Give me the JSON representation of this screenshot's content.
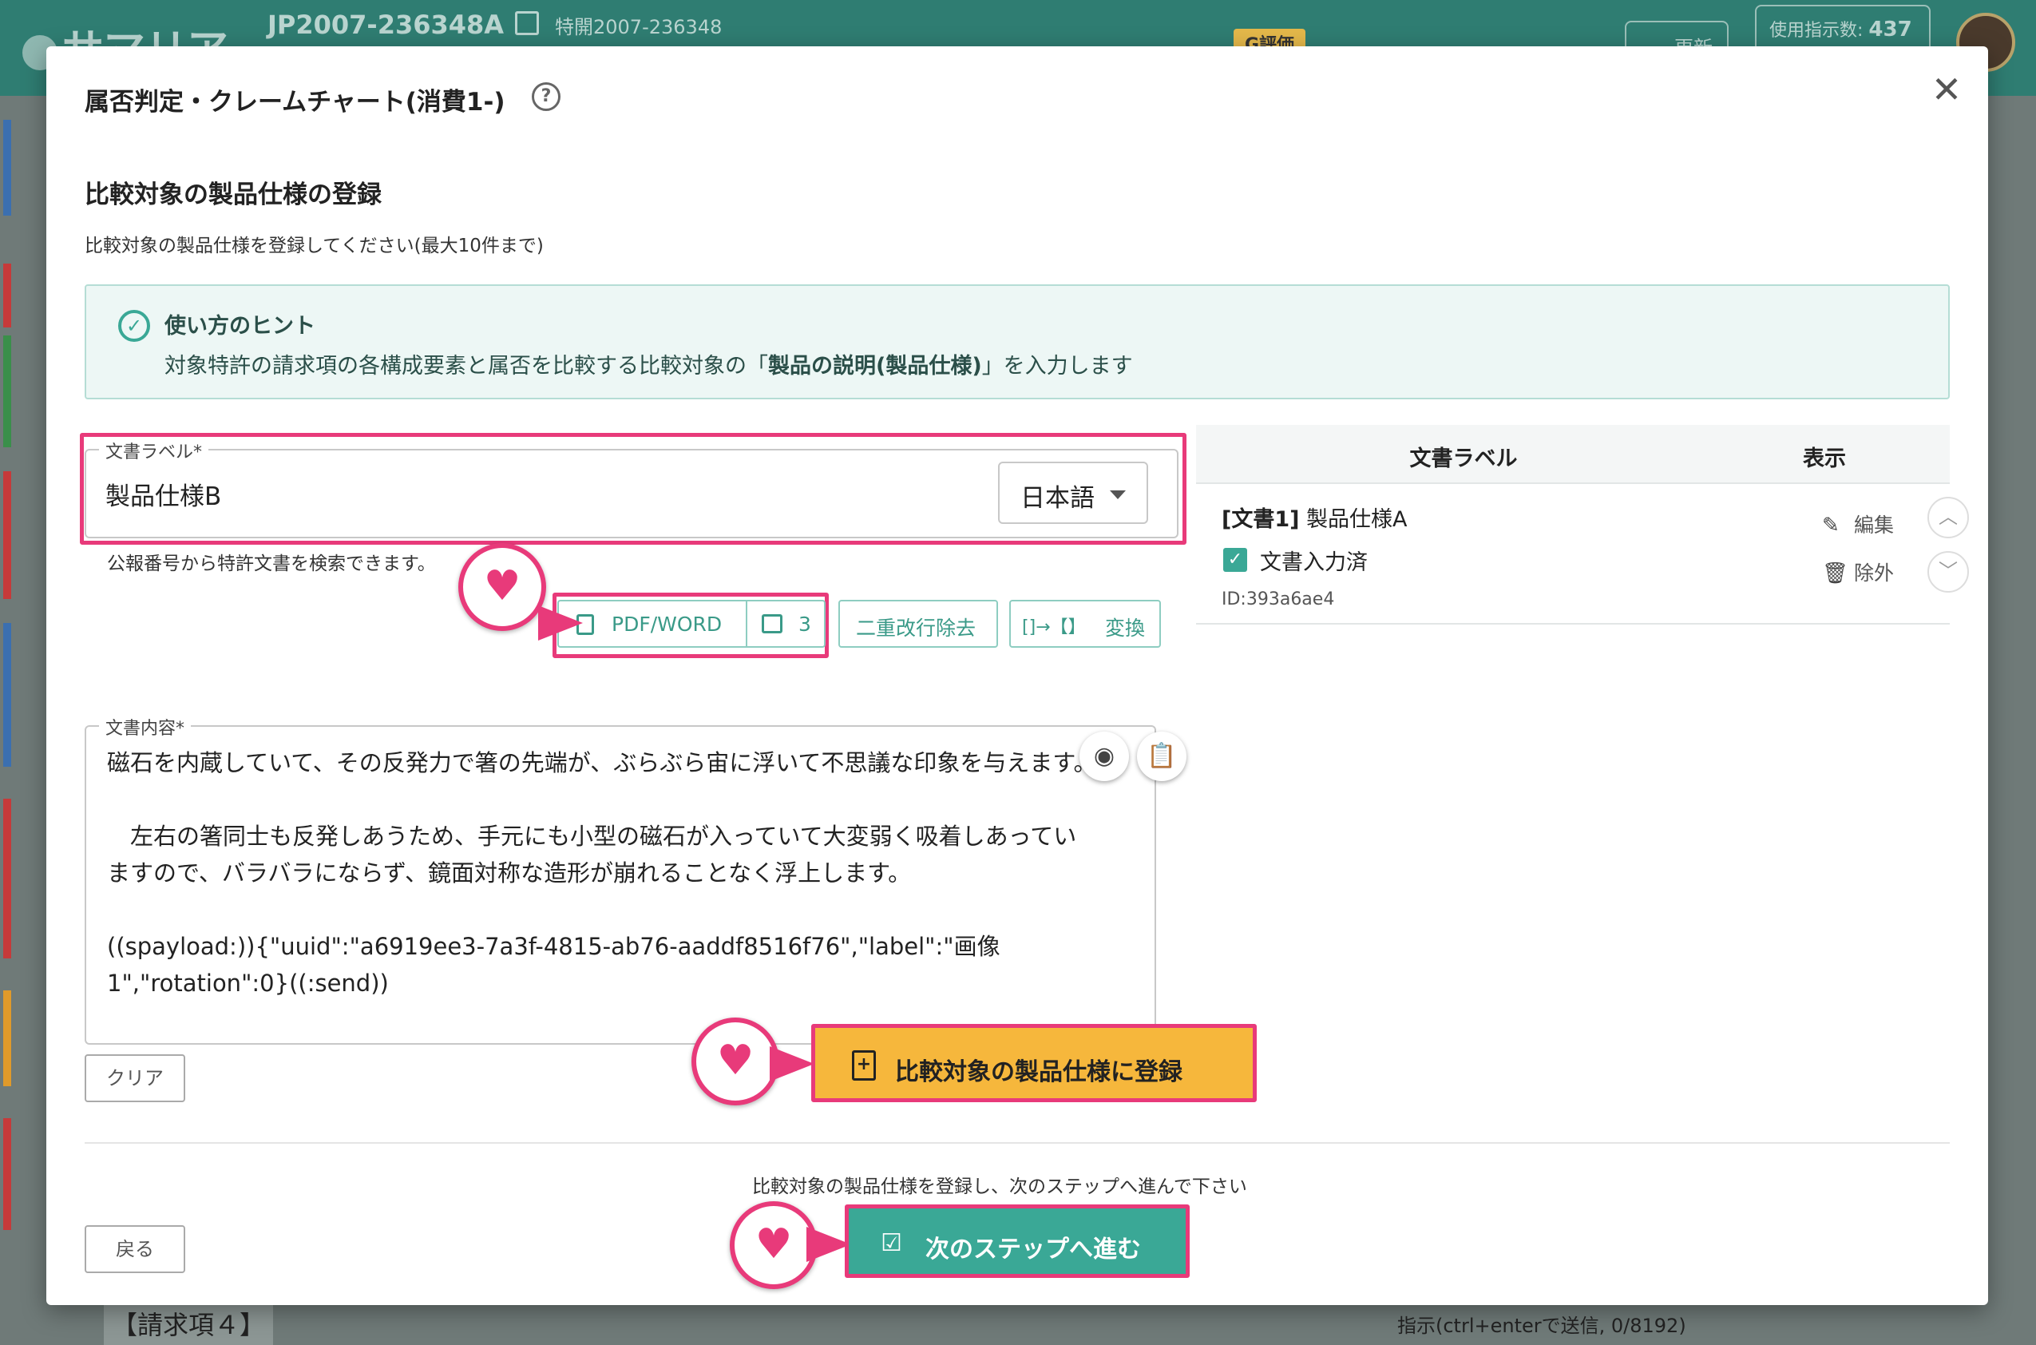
{
  "background": {
    "app_logo": "サマリア",
    "patent_number": "JP2007-236348A",
    "publication_number": "特開2007-236348",
    "rating_badge": "G評価",
    "update_button": "更新",
    "usage_label": "使用指示数:",
    "usage_value": "437",
    "claim_heading": "【請求項４】",
    "chat_input_hint": "指示(ctrl+enterで送信, 0/8192)"
  },
  "modal": {
    "title": "属否判定・クレームチャート(消費1-)",
    "section_title": "比較対象の製品仕様の登録",
    "section_desc": "比較対象の製品仕様を登録してください(最大10件まで)",
    "hint": {
      "title": "使い方のヒント",
      "text_before": "対象特許の請求項の各構成要素と属否を比較する比較対象の「",
      "text_bold": "製品の説明(製品仕様)",
      "text_after": "」を入力します"
    },
    "label_field": {
      "legend": "文書ラベル*",
      "value": "製品仕様B",
      "language": "日本語"
    },
    "search_hint": "公報番号から特許文書を検索できます。",
    "toolbar": {
      "pdf_word": "PDF/WORD",
      "image_count": "3",
      "remove_double_newline": "二重改行除去",
      "convert_icon": "[]→【】",
      "convert": "変換"
    },
    "content_field": {
      "legend": "文書内容*",
      "value": "磁石を内蔵していて、その反発力で箸の先端が、ぶらぶら宙に浮いて不思議な印象を与えます。\n\n　左右の箸同士も反発しあうため、手元にも小型の磁石が入っていて大変弱く吸着しあっていますので、バラバラにならず、鏡面対称な造形が崩れることなく浮上します。\n\n((spayload:)){\"uuid\":\"a6919ee3-7a3f-4815-ab76-aaddf8516f76\",\"label\":\"画像1\",\"rotation\":0}((:send))"
    },
    "clear_button": "クリア",
    "register_button": "比較対象の製品仕様に登録",
    "next_hint": "比較対象の製品仕様を登録し、次のステップへ進んで下さい",
    "back_button": "戻る",
    "next_button": "次のステップへ進む",
    "doc_table": {
      "col_label": "文書ラベル",
      "col_display": "表示",
      "rows": [
        {
          "prefix": "[文書1]",
          "name": "製品仕様A",
          "status": "文書入力済",
          "id": "ID:393a6ae4",
          "edit": "編集",
          "remove": "除外"
        }
      ]
    }
  },
  "colors": {
    "accent": "#3aa896",
    "highlight": "#e83a7a",
    "register": "#f6b73c",
    "header": "#2f7d72"
  }
}
